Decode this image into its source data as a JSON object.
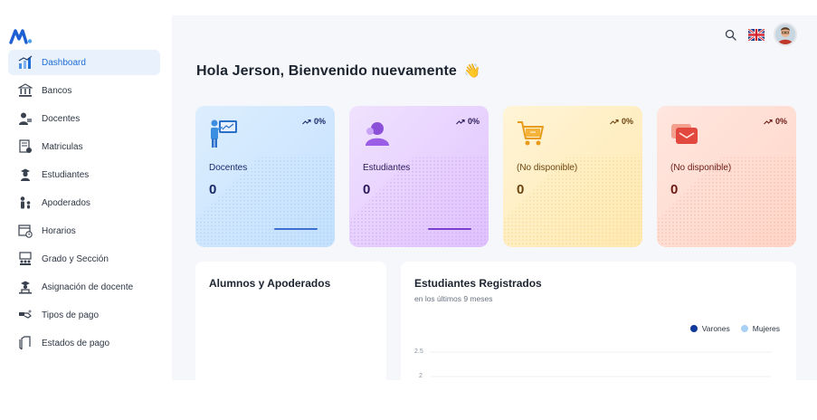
{
  "sidebar": {
    "items": [
      {
        "label": "Dashboard",
        "icon": "dashboard-chart-icon",
        "active": true
      },
      {
        "label": "Bancos",
        "icon": "bank-icon"
      },
      {
        "label": "Docentes",
        "icon": "teacher-icon"
      },
      {
        "label": "Matriculas",
        "icon": "enrollment-icon"
      },
      {
        "label": "Estudiantes",
        "icon": "student-icon"
      },
      {
        "label": "Apoderados",
        "icon": "guardian-icon"
      },
      {
        "label": "Horarios",
        "icon": "schedule-icon"
      },
      {
        "label": "Grado y Sección",
        "icon": "classroom-icon"
      },
      {
        "label": "Asignación de docente",
        "icon": "teacher-assign-icon"
      },
      {
        "label": "Tipos de pago",
        "icon": "payment-type-icon"
      },
      {
        "label": "Estados de pago",
        "icon": "payment-status-icon"
      }
    ]
  },
  "header": {
    "greeting": "Hola Jerson, Bienvenido nuevamente",
    "greeting_emoji": "👋"
  },
  "stats": [
    {
      "label": "Docentes",
      "value": "0",
      "trend": "0%",
      "color": "#1a2a6b",
      "accent": "#3b8ee0"
    },
    {
      "label": "Estudiantes",
      "value": "0",
      "trend": "0%",
      "color": "#2a1a5b",
      "accent": "#9b5de5"
    },
    {
      "label": "(No disponible)",
      "value": "0",
      "trend": "0%",
      "color": "#6b4410",
      "accent": "#f2a93b"
    },
    {
      "label": "(No disponible)",
      "value": "0",
      "trend": "0%",
      "color": "#6b1a14",
      "accent": "#e2483d"
    }
  ],
  "panels": {
    "left_title": "Alumnos y Apoderados",
    "right_title": "Estudiantes Registrados",
    "right_subtitle": "en los últimos 9 meses",
    "legend": [
      {
        "name": "Varones",
        "color": "#123a9a"
      },
      {
        "name": "Mujeres",
        "color": "#a9d0f5"
      }
    ],
    "y_ticks": [
      "2.5",
      "2"
    ]
  },
  "colors": {
    "accent": "#1e6ed8",
    "sidebar_active_bg": "#e8f1fc",
    "main_bg": "#f5f7fa"
  }
}
